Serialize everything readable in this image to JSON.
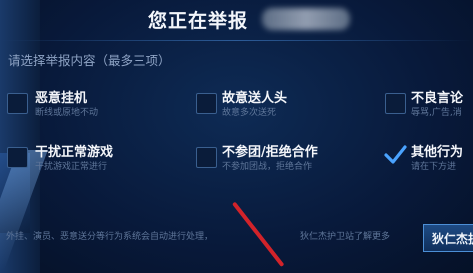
{
  "dialog": {
    "title": "您正在举报",
    "reported_player_blurred": "",
    "subtitle": "请选择举报内容（最多三项）",
    "close_icon": "close-icon"
  },
  "options": [
    {
      "label": "恶意挂机",
      "desc": "断线或原地不动",
      "checked": false
    },
    {
      "label": "故意送人头",
      "desc": "故意多次送死",
      "checked": false
    },
    {
      "label": "不良言论",
      "desc": "辱骂,广告,消",
      "checked": false
    },
    {
      "label": "干扰正常游戏",
      "desc": "干扰游戏正常进行",
      "checked": false
    },
    {
      "label": "不参团/拒绝合作",
      "desc": "不参加团战，拒绝合作",
      "checked": false
    },
    {
      "label": "其他行为",
      "desc": "请在下方进",
      "checked": true
    }
  ],
  "footer": {
    "hint_left": "外挂、演员、恶意送分等行为系统会自动进行处理，",
    "hint_right": "狄仁杰护卫站了解更多",
    "button_label": "狄仁杰护"
  },
  "colors": {
    "accent": "#4aa3ff",
    "check": "#4aa3ff",
    "arrow": "#d2232a"
  }
}
